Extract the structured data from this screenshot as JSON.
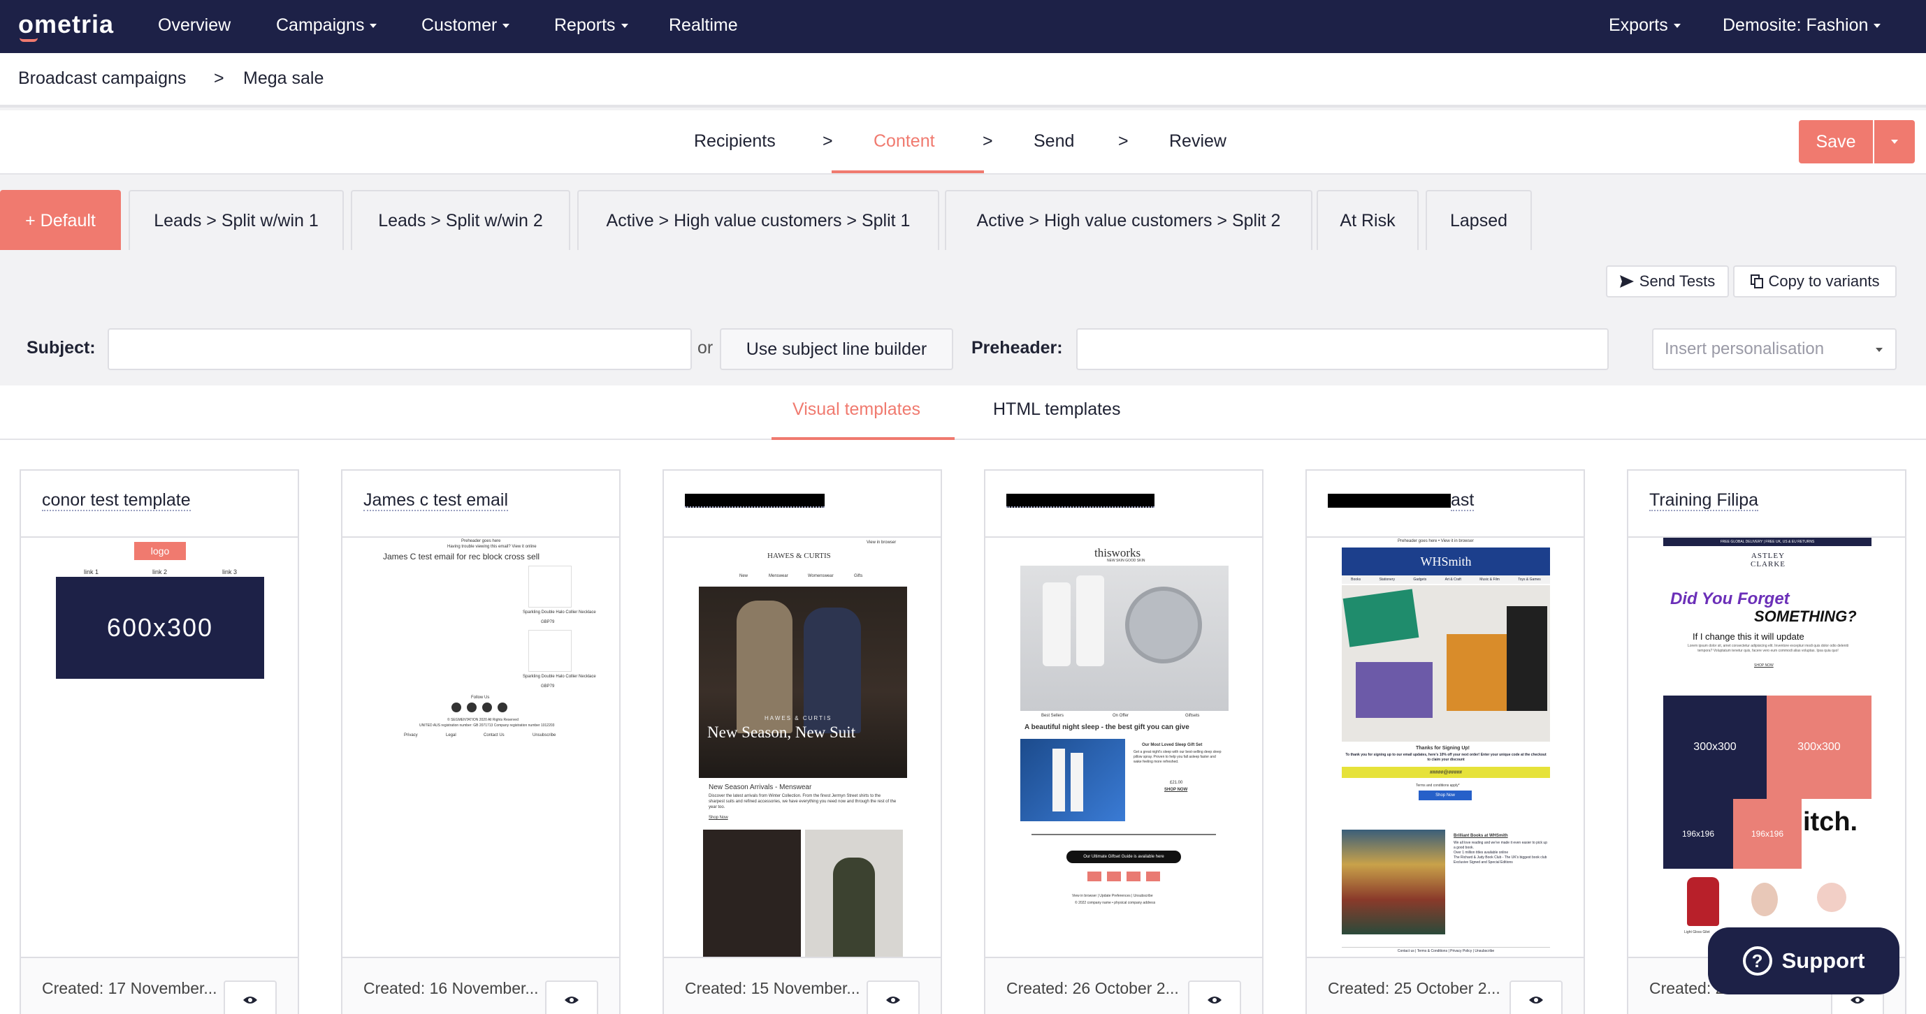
{
  "nav": {
    "logo": "ometria",
    "items": [
      "Overview",
      "Campaigns",
      "Customer",
      "Reports",
      "Realtime"
    ],
    "right": [
      "Exports",
      "Demosite: Fashion"
    ]
  },
  "breadcrumb": {
    "parent": "Broadcast campaigns",
    "sep": ">",
    "current": "Mega sale"
  },
  "steps": {
    "recipients": "Recipients",
    "content": "Content",
    "send": "Send",
    "review": "Review",
    "sep": ">"
  },
  "save_label": "Save",
  "variants": [
    "+ Default",
    "Leads > Split w/win 1",
    "Leads > Split w/win 2",
    "Active > High value customers > Split 1",
    "Active > High value customers > Split 2",
    "At Risk",
    "Lapsed"
  ],
  "actions": {
    "send_tests": "Send Tests",
    "copy_variants": "Copy to variants"
  },
  "subject": {
    "label": "Subject:",
    "value": "",
    "or": "or",
    "builder": "Use subject line builder",
    "preheader_label": "Preheader:",
    "preheader_value": "",
    "personalisation": "Insert personalisation"
  },
  "template_tabs": {
    "visual": "Visual templates",
    "html": "HTML templates"
  },
  "cards": [
    {
      "title": "conor test template",
      "created": "Created: 17 November..."
    },
    {
      "title": "James c test email",
      "created": "Created: 16 November..."
    },
    {
      "title": "",
      "created": "Created: 15 November..."
    },
    {
      "title": "",
      "created": "Created: 26 October 2..."
    },
    {
      "title": "ast",
      "created": "Created: 25 October 2..."
    },
    {
      "title": "Training Filipa",
      "created": "Created: 2"
    }
  ],
  "previews": {
    "conor": {
      "logo": "logo",
      "links": [
        "link 1",
        "link 2",
        "link 3"
      ],
      "banner": "600x300"
    },
    "james": {
      "pre1": "Preheader goes here",
      "pre2": "Having trouble viewing this email? View it online",
      "heading": "James C test email for rec block cross sell",
      "item1": "Sparkling Double Halo Collier Necklace",
      "price1": "GBP79",
      "item2": "Sparkling Double Halo Collier Necklace",
      "price2": "GBP79",
      "follow": "Follow Us",
      "legal1": "© SEGMENTATION 2020 All Rights Reserved",
      "legal2": "UNITED AUS registration number: GB 2071713 Company registration number 1012203",
      "f1": "Privacy",
      "f2": "Legal",
      "f3": "Contact Us",
      "f4": "Unsubscribe"
    },
    "hawes": {
      "brand": "HAWES & CURTIS",
      "online": "View in browser",
      "menu": [
        "New",
        "Menswear",
        "Womenswear",
        "Gifts"
      ],
      "hero_brand": "HAWES & CURTIS",
      "hero": "New Season, New Suit",
      "sub": "New Season Arrivals - Menswear",
      "body": "Discover the latest arrivals from Winter Collection. From the finest Jermyn Street shirts to the sharpest suits and refined accessories, we have everything you need now and through the rest of the year too.",
      "link": "Shop Now"
    },
    "thisworks": {
      "brand": "thisworks",
      "tagline": "NEW SKIN GOOD SKIN",
      "menu": [
        "Best Sellers",
        "On Offer",
        "Giftsets"
      ],
      "headline": "A beautiful night sleep - the best gift you can give",
      "gift": "Our Most Loved Sleep Gift Set",
      "gift_body": "Get a great night's sleep with our best-selling deep sleep pillow spray. Proven to help you fall asleep faster and wake feeling more refreshed.",
      "price": "£21.00",
      "shop": "SHOP NOW",
      "guide": "Our Ultimate Giftset Guide is available here",
      "footer1": "View in browser | Update Preferences | Unsubscribe",
      "footer2": "© 2022 company name • physical company address"
    },
    "whsmith": {
      "pre": "Preheader goes here • View it in browser",
      "brand": "WHSmith",
      "menu": [
        "Books",
        "Stationery",
        "Gadgets",
        "Art & Craft",
        "Music & Film",
        "Toys & Games"
      ],
      "thanks": "Thanks for Signing Up!",
      "offer": "To thank you for signing up to our email updates, here's 10% off your next order! Enter your unique code at the checkout to claim your discount",
      "code": "#####@#####",
      "terms": "Terms and conditions apply*",
      "shop": "Shop Now",
      "brilliant": "Brilliant Books at WHSmith",
      "b1": "We all love reading and we've made it even easier to pick up a good book.",
      "b2": "Over 1 million titles available online",
      "b3": "The Richard & Judy Book Club - The UK's biggest book club",
      "b4": "Exclusive Signed and Special Editions",
      "footer": "Contact us | Terms & Conditions | Privacy Policy | Unsubscribe"
    },
    "filipa": {
      "banner": "FREE GLOBAL DELIVERY | FREE UK, US & EU RETURNS",
      "brand": "ASTLEY CLARKE",
      "did": "Did You Forget",
      "something": "SOMETHING?",
      "change": "If I change this it will update",
      "lorem": "Lorem ipsum dolor sit, amet consectetur adipisicing elit. Inventore excepturi modi quis dolor odio deleniti tempora? Voluptatum tenetur quis, facere vero eum commodi alias voluptas. Ipsa quia quo!",
      "shop": "SHOP NOW",
      "img1": "300x300",
      "img2": "300x300",
      "img3": "196x196",
      "img4": "196x196",
      "itch": "itch.",
      "product": "Light Gloss Gilet"
    }
  },
  "support": "Support",
  "colors": {
    "nav": "#1d2147",
    "accent": "#f07a6f"
  }
}
